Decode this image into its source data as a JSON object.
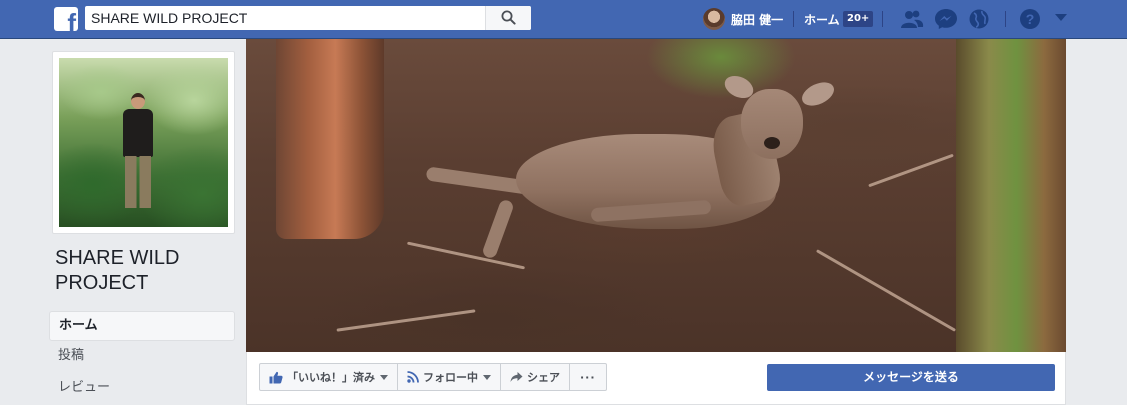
{
  "topbar": {
    "search_value": "SHARE WILD PROJECT",
    "user_name": "脇田 健一",
    "home_label": "ホーム",
    "home_count": "20+",
    "colors": {
      "bar": "#4267b2",
      "accent": "#4267b2"
    }
  },
  "page": {
    "name": "SHARE WILD PROJECT"
  },
  "nav": {
    "items": [
      {
        "label": "ホーム",
        "active": true
      },
      {
        "label": "投稿",
        "active": false
      },
      {
        "label": "レビュー",
        "active": false
      }
    ]
  },
  "actions": {
    "like_label": "「いいね！」済み",
    "follow_label": "フォロー中",
    "share_label": "シェア",
    "more_label": "···",
    "message_label": "メッセージを送る"
  },
  "icons": [
    "facebook-logo",
    "search-icon",
    "friends-icon",
    "messenger-icon",
    "globe-icon",
    "help-icon",
    "caret-down-icon",
    "thumbs-up-icon",
    "rss-icon",
    "share-arrow-icon"
  ]
}
